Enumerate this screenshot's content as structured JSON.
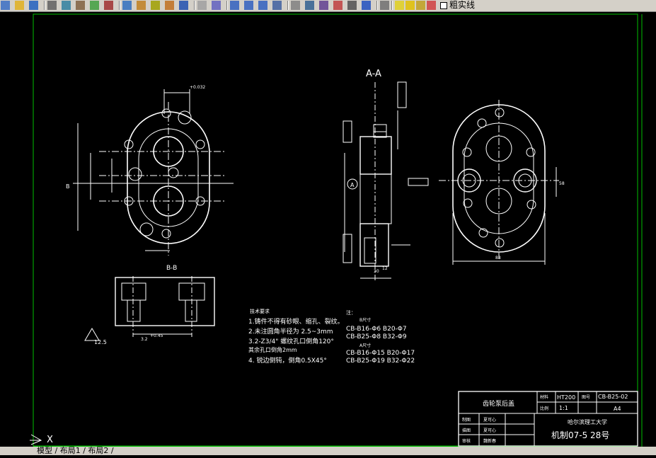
{
  "toolbar": {
    "icons": [
      "new-icon",
      "open-icon",
      "save-icon",
      "print-icon",
      "preview-icon",
      "publish-icon",
      "plot-icon",
      "cut-icon",
      "copy-icon",
      "paste-icon",
      "match-prop-icon",
      "brush-icon",
      "undo-icon",
      "redo-icon",
      "pan-icon",
      "zoom-realtime-icon",
      "zoom-window-icon",
      "zoom-previous-icon",
      "properties-icon",
      "design-center-icon",
      "tool-palette-icon",
      "sheet-set-icon",
      "markup-icon",
      "calculator-icon",
      "help-icon",
      "layer-icon",
      "lightbulb-icon",
      "sun-icon",
      "lock-icon",
      "color-swatch-icon"
    ],
    "layer_name": "粗实线"
  },
  "drawing": {
    "section_aa": "A-A",
    "section_bb": "B-B",
    "dims": {
      "d_0_032": "+0.032",
      "d_05": "0.5",
      "b": "B",
      "d_f0_02": "0.02",
      "r45": "R45",
      "d_0_04": "+0.04",
      "a": "A",
      "c_0_5": "0.5",
      "d_0_08": "0.08",
      "d_0_02b": "0.02",
      "d_0_04b": "+0.04",
      "d_30": "30",
      "d_12": "12",
      "d_88": "88",
      "d_58": "58",
      "d_s": "45",
      "d_12_5": "12.5",
      "d_3_2": "3.2",
      "d_0_45": "+0.45"
    },
    "notes": {
      "title": "技术要求",
      "lines": [
        "1.铸件不得有砂眼、缩孔、裂纹。",
        "2.未注圆角半径为 2.5~3mm",
        "3.2-Z3/4\" 螺纹孔口倒角120°",
        "  其余孔口倒角2mm",
        "4. 锐边倒钝，倒角0.5X45°"
      ]
    },
    "table_notes": {
      "title": "注：",
      "sub1": "B尺寸",
      "row1": "CB-B16-Φ6    B20-Φ7",
      "row2": "CB-B25-Φ8    B32-Φ9",
      "sub2": "A尺寸",
      "row3": "CB-B16-Φ15   B20-Φ17",
      "row4": "CB-B25-Φ19  B32-Φ22"
    },
    "title_block": {
      "part_name": "齿轮泵后盖",
      "material_label": "材料",
      "material": "HT200",
      "scale_label": "比例",
      "scale": "1:1",
      "drawing_no_label": "图号",
      "drawing_no": "CB-B25-02",
      "sheet_size": "A4",
      "designer_label": "制图",
      "designer_val": "夏可心",
      "checker_label": "描图",
      "checker_val": "夏可心",
      "reviewer_label": "审核",
      "reviewer_val": "魏新春",
      "school": "哈尔滨理工大学",
      "class": "机制07-5  28号"
    }
  },
  "layout_tabs": "模型 / 布局1 / 布局2 /",
  "ucs_axis": "X",
  "colors": {
    "background": "#000000",
    "lines": "#ffffff",
    "frame": "#00c000",
    "ui": "#d4d0c8"
  }
}
